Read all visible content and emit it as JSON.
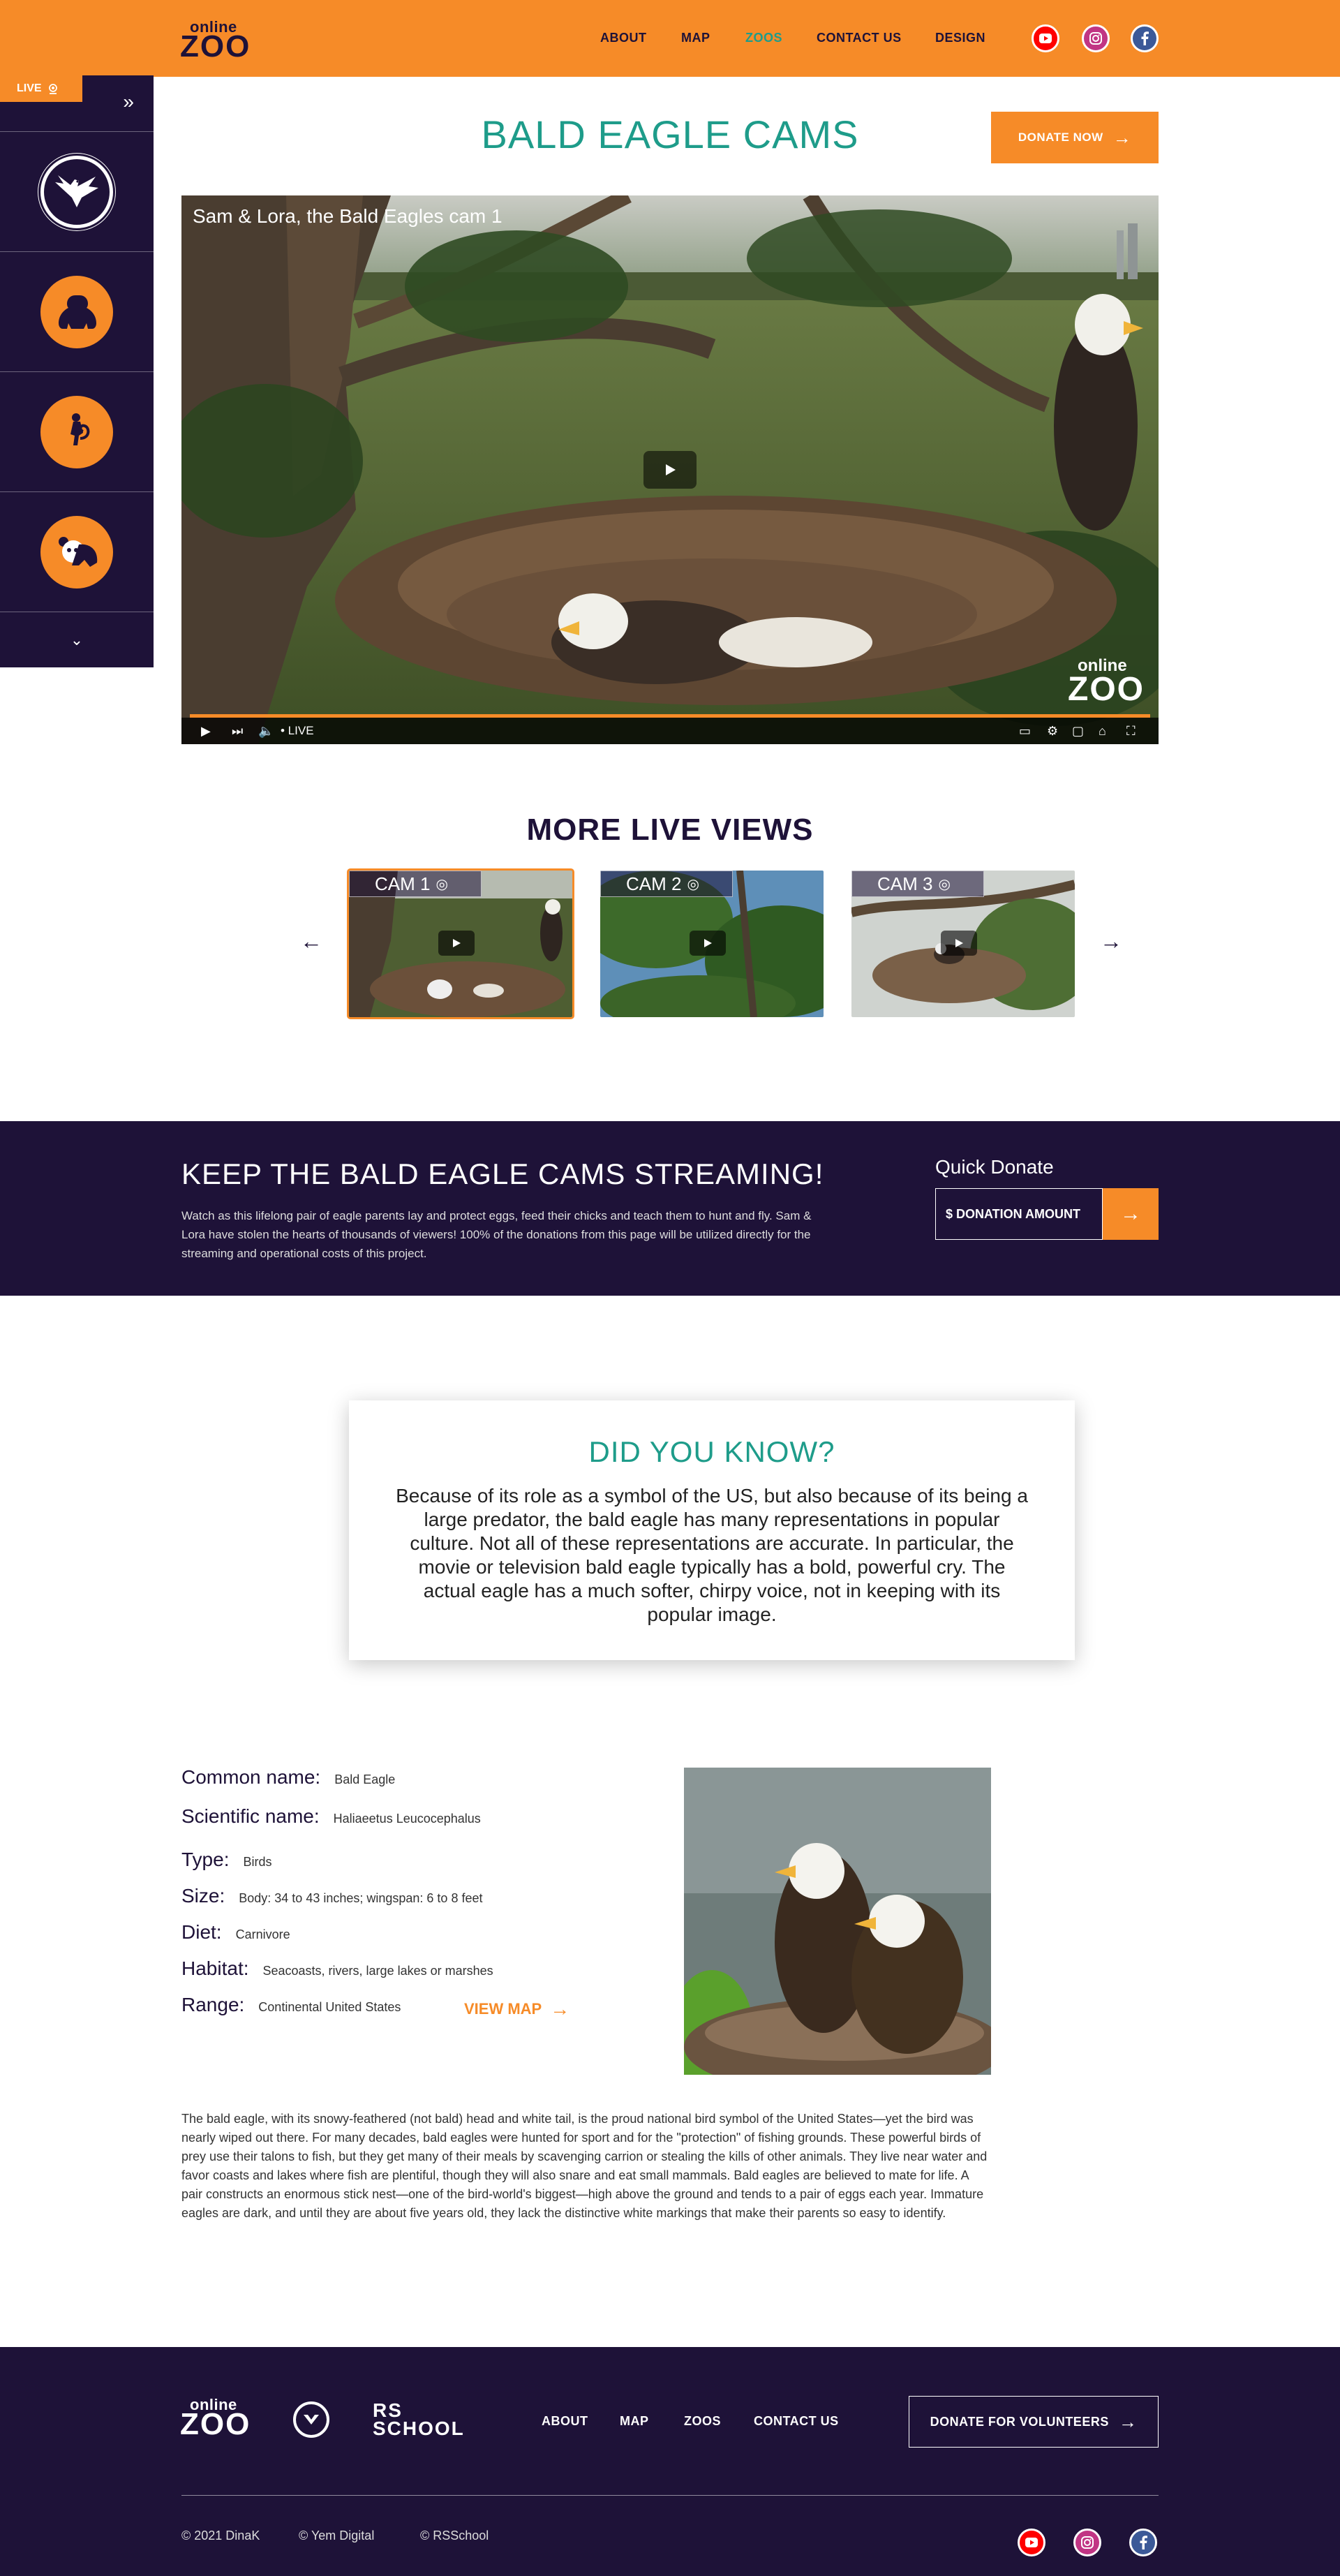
{
  "header": {
    "logo_small": "online",
    "logo_big": "ZOO",
    "nav": [
      {
        "label": "ABOUT"
      },
      {
        "label": "MAP"
      },
      {
        "label": "ZOOS",
        "active": true
      },
      {
        "label": "CONTACT US"
      },
      {
        "label": "DESIGN"
      }
    ],
    "social": [
      "youtube-icon",
      "instagram-icon",
      "facebook-icon"
    ]
  },
  "sidebar": {
    "live_label": "LIVE",
    "items": [
      {
        "name": "eagle",
        "icon": "eagle-icon",
        "active": true
      },
      {
        "name": "gorilla",
        "icon": "gorilla-icon"
      },
      {
        "name": "lemur",
        "icon": "lemur-icon"
      },
      {
        "name": "panda",
        "icon": "panda-icon"
      }
    ]
  },
  "main": {
    "title": "BALD EAGLE CAMS",
    "donate_button": "DONATE NOW",
    "video": {
      "title": "Sam & Lora, the Bald Eagles cam 1",
      "live_label": "• LIVE",
      "logo_small": "online",
      "logo_big": "ZOO"
    }
  },
  "more_views": {
    "heading": "MORE LIVE VIEWS",
    "cams": [
      {
        "label": "CAM 1",
        "active": true
      },
      {
        "label": "CAM 2"
      },
      {
        "label": "CAM 3"
      }
    ]
  },
  "streaming": {
    "heading": "KEEP THE BALD EAGLE CAMS STREAMING!",
    "text": "Watch as this lifelong pair of eagle parents lay and protect eggs, feed their chicks and teach them to hunt and fly. Sam & Lora have stolen the hearts of thousands of viewers! 100% of the donations from this page will be utilized directly for the streaming and operational costs of this project.",
    "quick_donate": "Quick Donate",
    "amount_placeholder": "$ DONATION AMOUNT"
  },
  "did_you_know": {
    "heading": "DID YOU KNOW?",
    "text": "Because of its role as a symbol of the US, but also because of its being a large predator, the bald eagle has many representations in popular culture. Not all of these representations are accurate. In particular, the movie or television bald eagle typically has a bold, powerful cry. The actual eagle has a much softer, chirpy voice, not in keeping with its popular image."
  },
  "facts": [
    {
      "key": "Common name:",
      "value": "Bald Eagle"
    },
    {
      "key": "Scientific name:",
      "value": "Haliaeetus Leucocephalus"
    },
    {
      "key": "Type:",
      "value": "Birds"
    },
    {
      "key": "Size:",
      "value": "Body: 34 to 43 inches; wingspan: 6 to 8 feet"
    },
    {
      "key": "Diet:",
      "value": "Carnivore"
    },
    {
      "key": "Habitat:",
      "value": "Seacoasts, rivers, large lakes or marshes"
    },
    {
      "key": "Range:",
      "value": "Continental United States"
    }
  ],
  "view_map": "VIEW MAP",
  "description": "The bald eagle, with its snowy-feathered (not bald) head and white tail, is the proud national bird symbol of the United States—yet the bird was nearly wiped out there. For many decades, bald eagles were hunted for sport and for the \"protection\" of fishing grounds.  These powerful birds of prey use their talons to fish, but they get many of their meals by scavenging carrion or stealing the kills of other animals. They live near water and favor coasts and lakes where fish are plentiful, though they will also snare and eat small mammals. Bald eagles are believed to mate for life. A pair constructs an enormous stick nest—one of the bird-world's biggest—high above the ground and tends to a pair of eggs each year. Immature eagles are dark, and until they are about five years old, they lack the distinctive white markings that make their parents so easy to identify.",
  "footer": {
    "logo_small": "online",
    "logo_big": "ZOO",
    "school_logo": "RS SCHOOL",
    "nav": [
      "ABOUT",
      "MAP",
      "ZOOS",
      "CONTACT US"
    ],
    "volunteer_button": "DONATE FOR VOLUNTEERS",
    "copyright": [
      "© 2021 DinaK",
      "© Yem Digital",
      "© RSSchool"
    ]
  },
  "colors": {
    "orange": "#f68b28",
    "purple": "#1e1238",
    "teal": "#1e9c8a"
  }
}
